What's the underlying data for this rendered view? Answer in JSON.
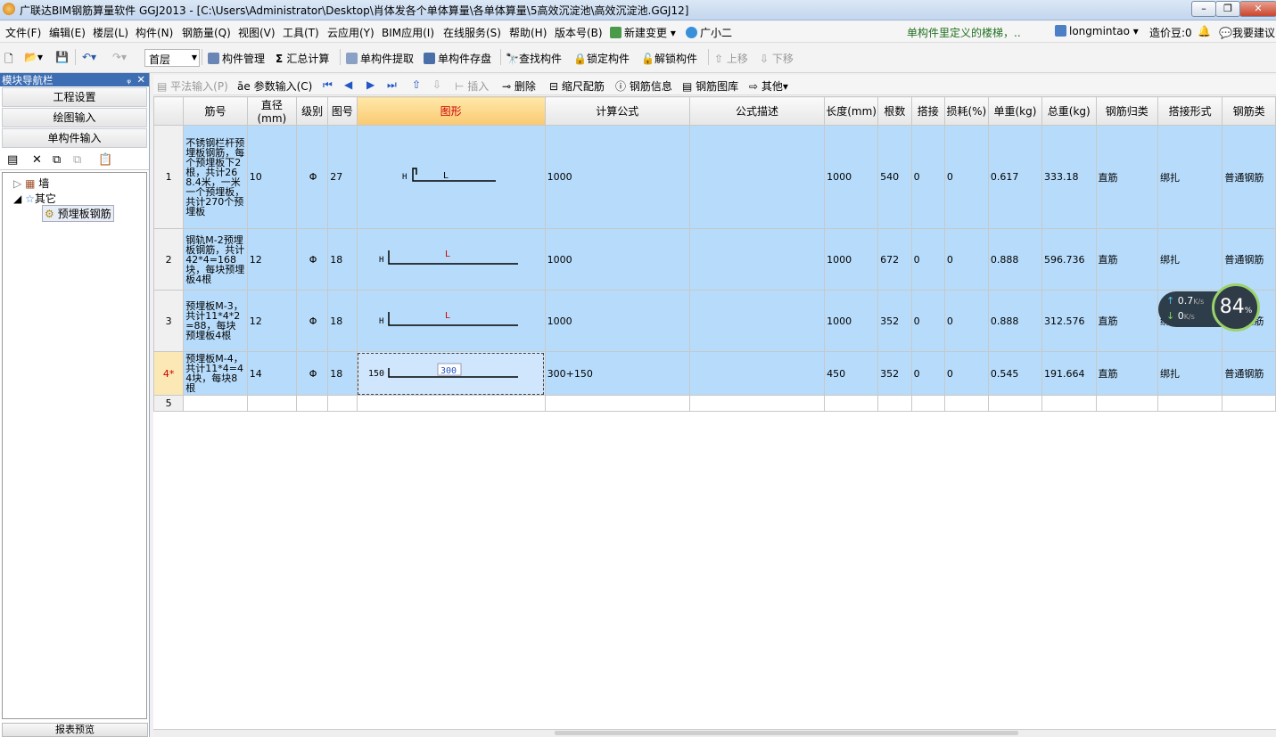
{
  "window": {
    "title": "广联达BIM钢筋算量软件 GGJ2013 - [C:\\Users\\Administrator\\Desktop\\肖体发各个单体算量\\各单体算量\\5高效沉淀池\\高效沉淀池.GGJ12]"
  },
  "menu": {
    "items": [
      "文件(F)",
      "编辑(E)",
      "楼层(L)",
      "构件(N)",
      "钢筋量(Q)",
      "视图(V)",
      "工具(T)",
      "云应用(Y)",
      "BIM应用(I)",
      "在线服务(S)",
      "帮助(H)",
      "版本号(B)"
    ],
    "new_change": "新建变更",
    "guangxiaoer": "广小二",
    "notice": "单构件里定义的楼梯，..",
    "user": "longmintao",
    "bean": "造价豆:0",
    "suggest": "我要建议"
  },
  "toolbar": {
    "floor": "首层",
    "component_manage": "构件管理",
    "sum_calc": "汇总计算",
    "extract": "单构件提取",
    "save_disk": "单构件存盘",
    "find": "查找构件",
    "lock": "锁定构件",
    "unlock": "解锁构件",
    "move_up": "上移",
    "move_down": "下移"
  },
  "nav": {
    "header": "模块导航栏",
    "project_settings": "工程设置",
    "drawing_input": "绘图输入",
    "single_input": "单构件输入",
    "tree": {
      "wall": "墙",
      "other": "其它",
      "embedded": "预埋板钢筋"
    },
    "footer": "报表预览"
  },
  "subtoolbar": {
    "flat_input": "平法输入(P)",
    "param_input": "参数输入(C)",
    "insert": "插入",
    "delete": "删除",
    "scale": "缩尺配筋",
    "info": "钢筋信息",
    "library": "钢筋图库",
    "other": "其他"
  },
  "grid": {
    "headers": [
      "筋号",
      "直径(mm)",
      "级别",
      "图号",
      "图形",
      "计算公式",
      "公式描述",
      "长度(mm)",
      "根数",
      "搭接",
      "损耗(%)",
      "单重(kg)",
      "总重(kg)",
      "钢筋归类",
      "搭接形式",
      "钢筋类"
    ],
    "rows": [
      {
        "no": "1",
        "name": "不锈钢栏杆预埋板钢筋，每个预埋板下2根，共计268.4米，一米一个预埋板，共计270个预埋板",
        "dia": "10",
        "grade": "Φ",
        "fig": "27",
        "shape_l": "H",
        "shape_m": "L",
        "formula": "1000",
        "desc": "",
        "len": "1000",
        "count": "540",
        "lap": "0",
        "loss": "0",
        "unit": "0.617",
        "total": "333.18",
        "cat": "直筋",
        "laptype": "绑扎",
        "type": "普通钢筋"
      },
      {
        "no": "2",
        "name": "钢轨M-2预埋板钢筋，共计42*4=168块，每块预埋板4根",
        "dia": "12",
        "grade": "Φ",
        "fig": "18",
        "shape_l": "H",
        "shape_m": "L",
        "formula": "1000",
        "desc": "",
        "len": "1000",
        "count": "672",
        "lap": "0",
        "loss": "0",
        "unit": "0.888",
        "total": "596.736",
        "cat": "直筋",
        "laptype": "绑扎",
        "type": "普通钢筋"
      },
      {
        "no": "3",
        "name": "预埋板M-3，共计11*4*2=88，每块预埋板4根",
        "dia": "12",
        "grade": "Φ",
        "fig": "18",
        "shape_l": "H",
        "shape_m": "L",
        "formula": "1000",
        "desc": "",
        "len": "1000",
        "count": "352",
        "lap": "0",
        "loss": "0",
        "unit": "0.888",
        "total": "312.576",
        "cat": "直筋",
        "laptype": "绑扎",
        "type": "普通钢筋"
      },
      {
        "no": "4*",
        "name": "预埋板M-4，共计11*4=44块，每块8根",
        "dia": "14",
        "grade": "Φ",
        "fig": "18",
        "shape_l": "150",
        "shape_m": "300",
        "formula": "300+150",
        "desc": "",
        "len": "450",
        "count": "352",
        "lap": "0",
        "loss": "0",
        "unit": "0.545",
        "total": "191.664",
        "cat": "直筋",
        "laptype": "绑扎",
        "type": "普通钢筋"
      },
      {
        "no": "5"
      }
    ]
  },
  "speed": {
    "up": "0.7",
    "down": "0",
    "unit": "K/s",
    "percent": "84",
    "percent_sign": "%"
  }
}
